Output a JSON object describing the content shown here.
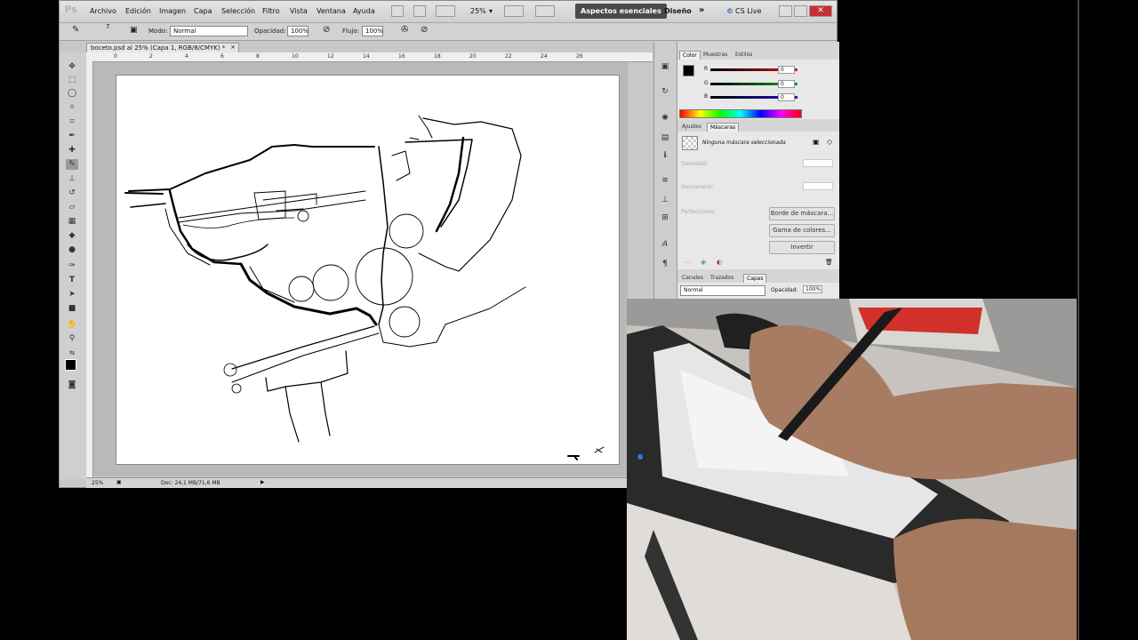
{
  "app": {
    "logo": "Ps",
    "menu": [
      "Archivo",
      "Edición",
      "Imagen",
      "Capa",
      "Selección",
      "Filtro",
      "Vista",
      "Ventana",
      "Ayuda"
    ],
    "zoom_menu": "25%",
    "workspace_active": "Aspectos esenciales",
    "workspace_other": "Diseño",
    "more": "»",
    "cslive": "CS Live"
  },
  "options_bar": {
    "brush_size": "7",
    "mode_label": "Modo:",
    "mode_value": "Normal",
    "opacity_label": "Opacidad:",
    "opacity_value": "100%",
    "flow_label": "Flujo:",
    "flow_value": "100%"
  },
  "document": {
    "tab_title": "boceto.psd al 25% (Capa 1, RGB/8/CMYK) *",
    "tab_close": "×",
    "ruler_ticks": [
      "0",
      "2",
      "4",
      "6",
      "8",
      "10",
      "12",
      "14",
      "16",
      "18",
      "20",
      "22",
      "24",
      "26"
    ],
    "status_zoom": "25%",
    "status_doc": "Doc: 24,1 MB/71,6 MB"
  },
  "color_panel": {
    "tabs": [
      "Color",
      "Muestras",
      "Estilos"
    ],
    "r_label": "R",
    "g_label": "G",
    "b_label": "B",
    "r_value": "0",
    "g_value": "0",
    "b_value": "0"
  },
  "masks_panel": {
    "tabs": [
      "Ajustes",
      "Máscaras"
    ],
    "status": "Ninguna máscara seleccionada",
    "density_label": "Densidad:",
    "feather_label": "Desvanecer:",
    "refine_label": "Perfeccionar:",
    "btn_edge": "Borde de máscara...",
    "btn_range": "Gama de colores...",
    "btn_invert": "Invertir"
  },
  "layers_panel": {
    "tabs": [
      "Canales",
      "Trazados",
      "Capas"
    ],
    "blend_mode": "Normal",
    "opacity_label": "Opacidad:",
    "opacity_value": "100%"
  },
  "colors": {
    "accent_dark": "#4a4a4a",
    "slider_red": "#d01818",
    "slider_green": "#18a018",
    "slider_blue": "#1818c8"
  }
}
